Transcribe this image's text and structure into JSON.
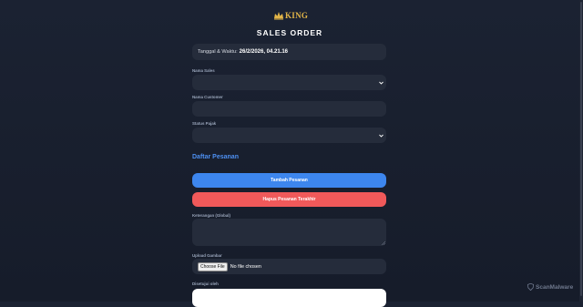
{
  "brand": {
    "logo_text": "KING"
  },
  "page": {
    "title": "SALES ORDER"
  },
  "datetime": {
    "label": "Tanggal & Waktu:",
    "value": "26/2/2026, 04.21.16"
  },
  "fields": {
    "nama_sales": {
      "label": "Nama Sales",
      "value": ""
    },
    "nama_customer": {
      "label": "Nama Customer",
      "value": ""
    },
    "status_pajak": {
      "label": "Status Pajak",
      "value": ""
    }
  },
  "orders": {
    "section_title": "Daftar Pesanan",
    "add_button": "Tambah Pesanan",
    "remove_button": "Hapus Pesanan Terakhir"
  },
  "keterangan": {
    "label": "Keterangan (Global)",
    "value": ""
  },
  "upload": {
    "label": "Upload Gambar",
    "button": "Choose File",
    "status": "No file chosen"
  },
  "approval": {
    "label": "Disetujui oleh"
  },
  "watermark": {
    "text": "ScanMalware"
  },
  "colors": {
    "accent_blue": "#3d86ee",
    "danger_red": "#f0595a",
    "section_blue": "#4d8ff0",
    "logo_gold": "#e2b548"
  }
}
